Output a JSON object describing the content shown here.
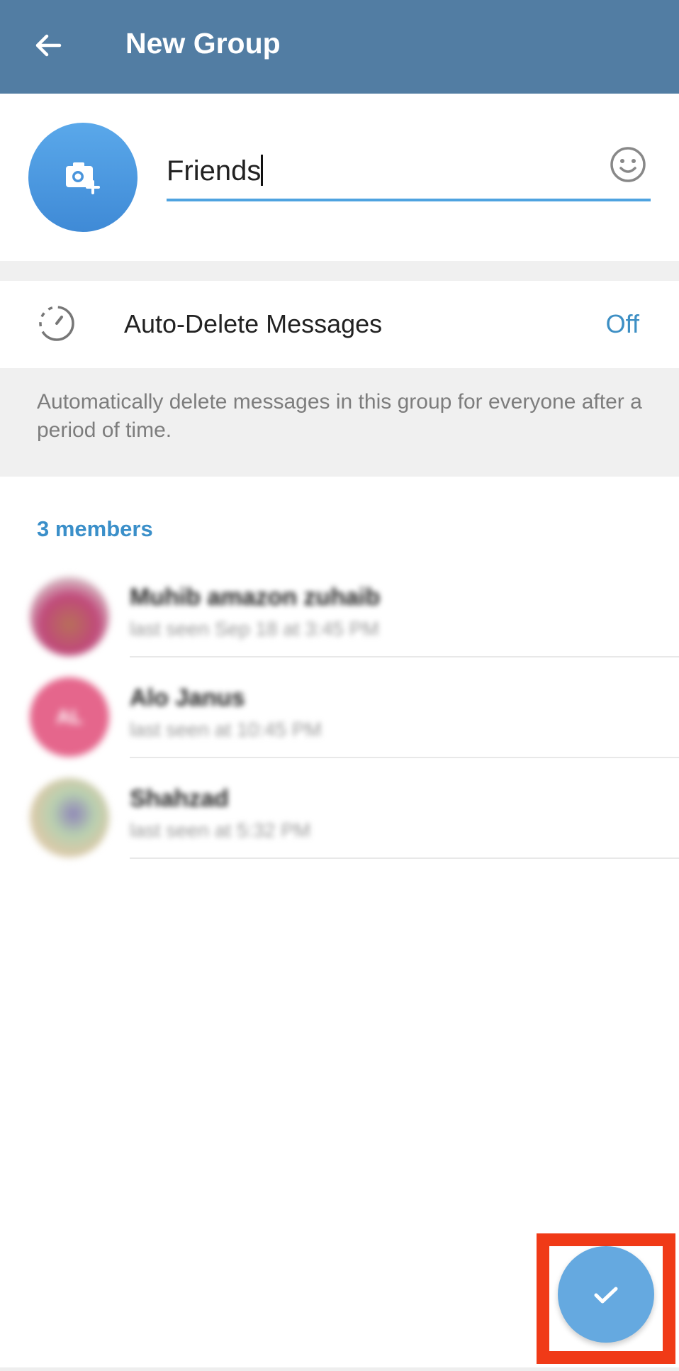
{
  "header": {
    "title": "New Group",
    "back_icon": "arrow-left-icon"
  },
  "group": {
    "name_value": "Friends",
    "avatar_icon": "camera-add-icon",
    "emoji_icon": "smiley-icon"
  },
  "auto_delete": {
    "label": "Auto-Delete Messages",
    "value": "Off",
    "icon": "timer-icon",
    "description": "Automatically delete messages in this group for everyone after a period of time."
  },
  "members": {
    "header": "3 members",
    "items": [
      {
        "name": "Muhib amazon zuhaib",
        "status": "last seen Sep 18 at 3:45 PM",
        "avatar_color": "#c0497a"
      },
      {
        "name": "Alo Janus",
        "status": "last seen at 10:45 PM",
        "avatar_color": "#e5668c",
        "initials": "AL"
      },
      {
        "name": "Shahzad",
        "status": "last seen at 5:32 PM",
        "avatar_color": "#c9b9a0"
      }
    ]
  },
  "fab": {
    "icon": "checkmark-icon"
  },
  "colors": {
    "header": "#527da3",
    "accent": "#3d8fc4",
    "fab": "#65a9e0",
    "highlight": "#f03a17"
  }
}
